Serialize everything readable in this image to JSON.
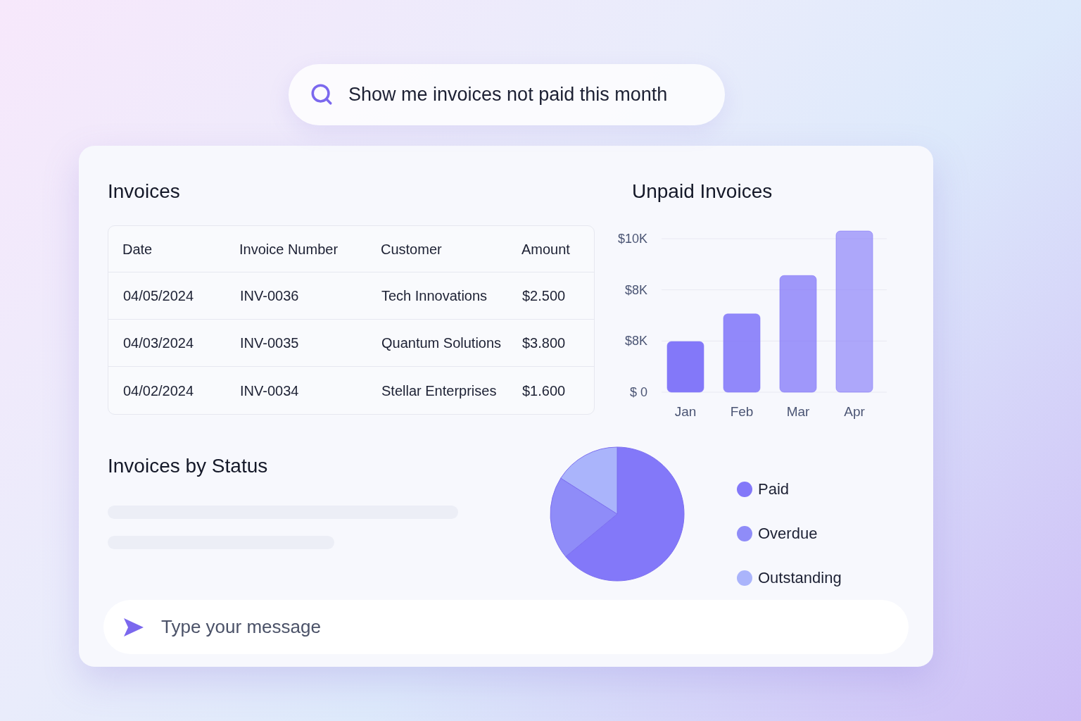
{
  "search": {
    "value": "Show me invoices not paid this month"
  },
  "invoices": {
    "title": "Invoices",
    "columns": [
      "Date",
      "Invoice Number",
      "Customer",
      "Amount"
    ],
    "rows": [
      [
        "04/05/2024",
        "INV-0036",
        "Tech Innovations",
        "$2.500"
      ],
      [
        "04/03/2024",
        "INV-0035",
        "Quantum Solutions",
        "$3.800"
      ],
      [
        "04/02/2024",
        "INV-0034",
        "Stellar Enterprises",
        "$1.600"
      ]
    ]
  },
  "unpaid": {
    "title": "Unpaid Invoices",
    "axis_labels": [
      "$10K",
      "$8K",
      "$8K",
      "$ 0"
    ],
    "months": [
      "Jan",
      "Feb",
      "Mar",
      "Apr"
    ]
  },
  "status": {
    "title": "Invoices by Status",
    "legend": [
      {
        "label": "Paid",
        "color": "#8378f9"
      },
      {
        "label": "Overdue",
        "color": "#8f8cf8"
      },
      {
        "label": "Outstanding",
        "color": "#aab4fb"
      }
    ]
  },
  "message": {
    "placeholder": "Type your message"
  }
}
